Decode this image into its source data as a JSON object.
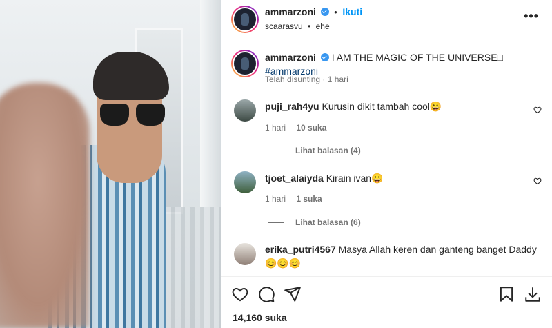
{
  "post": {
    "author": "ammarzoni",
    "follow_label": "Ikuti",
    "subline": {
      "audio": "scaarasvu",
      "separator": "•",
      "location": "ehe"
    },
    "more_label": "•••"
  },
  "caption": {
    "author": "ammarzoni",
    "text": "I AM THE MAGIC OF THE UNIVERSE□",
    "hashtag": "#ammarzoni",
    "edited": "Telah disunting",
    "separator": "·",
    "time": "1 hari"
  },
  "comments": [
    {
      "user": "puji_rah4yu",
      "text": "Kurusin dikit tambah cool😀",
      "time": "1 hari",
      "likes": "10 suka",
      "replies": "Lihat balasan (4)"
    },
    {
      "user": "tjoet_alaiyda",
      "text": "Kirain ivan😀",
      "time": "1 hari",
      "likes": "1 suka",
      "replies": "Lihat balasan (6)"
    },
    {
      "user": "erika_putri4567",
      "text": "Masya Allah keren dan ganteng banget Daddy",
      "emoji": "😊😊😊"
    }
  ],
  "footer": {
    "likes_total": "14,160 suka"
  },
  "icons": {
    "like": "heart-icon",
    "comment": "comment-icon",
    "share": "share-icon",
    "save": "bookmark-icon",
    "download": "download-icon"
  },
  "colors": {
    "link": "#0095f6",
    "hashtag": "#00376b",
    "muted": "#737373"
  }
}
